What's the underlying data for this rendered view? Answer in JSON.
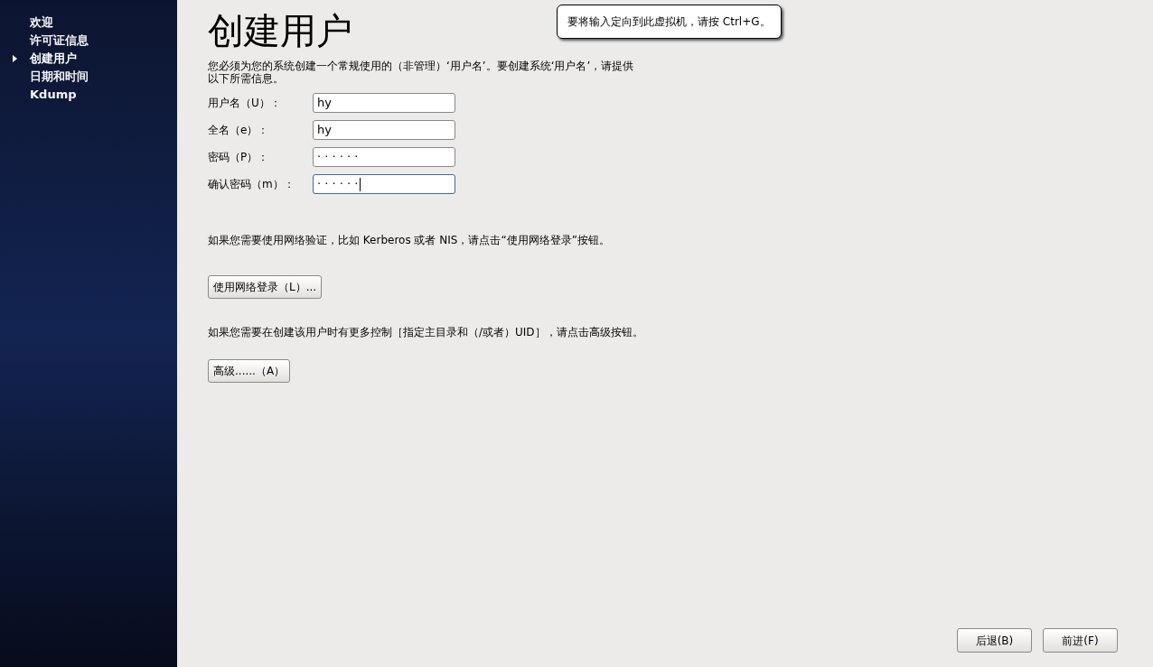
{
  "sidebar": {
    "items": [
      {
        "label": "欢迎",
        "selected": false
      },
      {
        "label": "许可证信息",
        "selected": false
      },
      {
        "label": "创建用户",
        "selected": true
      },
      {
        "label": "日期和时间",
        "selected": false
      },
      {
        "label": "Kdump",
        "selected": false
      }
    ]
  },
  "tooltip": "要将输入定向到此虚拟机，请按 Ctrl+G。",
  "title": "创建用户",
  "intro": "您必须为您的系统创建一个常规使用的（非管理）‘用户名’。要创建系统‘用户名’，请提供以下所需信息。",
  "fields": [
    {
      "label": "用户名（U）：",
      "value": "hy",
      "focused": false
    },
    {
      "label": "全名（e）：",
      "value": "hy",
      "focused": false
    },
    {
      "label": "密码（P）：",
      "value": "· · · · · ·",
      "focused": false
    },
    {
      "label": "确认密码（m）：",
      "value": "· · · · · ·",
      "focused": true
    }
  ],
  "network_note": "如果您需要使用网络验证，比如  Kerberos 或者  NIS，请点击“使用网络登录”按钮。",
  "network_button": "使用网络登录（L）...",
  "advanced_note": "如果您需要在创建该用户时有更多控制［指定主目录和（/或者）UID］，请点击高级按钮。",
  "advanced_button": "高级......（A）",
  "nav_buttons": [
    "后退(B)",
    "前进(F)"
  ]
}
